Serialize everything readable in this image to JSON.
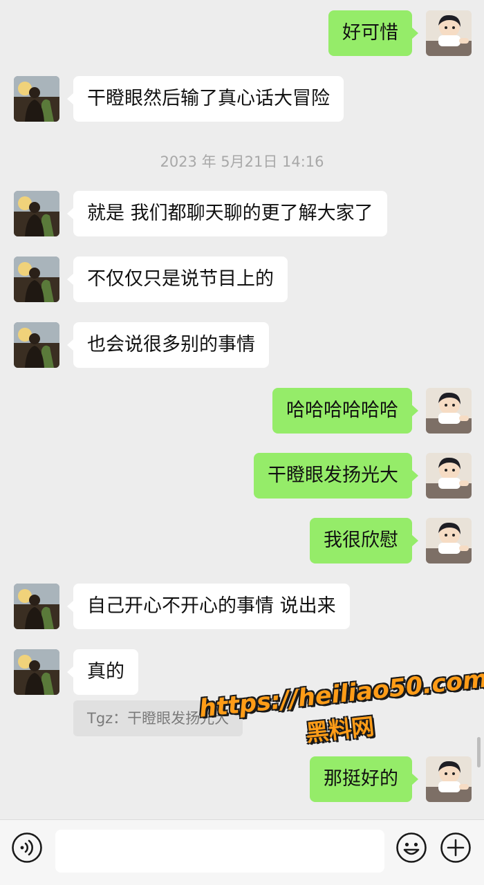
{
  "timestamp": "2023 年 5月21日 14:16",
  "messages": [
    {
      "side": "right",
      "text": "好可惜",
      "top": 0
    },
    {
      "side": "left",
      "text": "干瞪眼然后输了真心话大冒险"
    },
    {
      "side": "left",
      "text": "就是 我们都聊天聊的更了解大家了"
    },
    {
      "side": "left",
      "text": "不仅仅只是说节目上的"
    },
    {
      "side": "left",
      "text": "也会说很多别的事情"
    },
    {
      "side": "right",
      "text": "哈哈哈哈哈哈"
    },
    {
      "side": "right",
      "text": "干瞪眼发扬光大"
    },
    {
      "side": "right",
      "text": "我很欣慰"
    },
    {
      "side": "left",
      "text": "自己开心不开心的事情 说出来"
    },
    {
      "side": "left",
      "text": "真的"
    },
    {
      "side": "right",
      "text": "那挺好的"
    }
  ],
  "quote": "Tgz：干瞪眼发扬光大",
  "watermark": {
    "url": "https://heiliao50.com",
    "name": "黑料网"
  },
  "input": {
    "placeholder": ""
  },
  "icons": {
    "voice": "voice-icon",
    "emoji": "emoji-icon",
    "more": "plus-icon"
  },
  "colors": {
    "background": "#ededed",
    "sent_bubble": "#95ec69",
    "received_bubble": "#ffffff",
    "watermark": "#ff9c17"
  }
}
